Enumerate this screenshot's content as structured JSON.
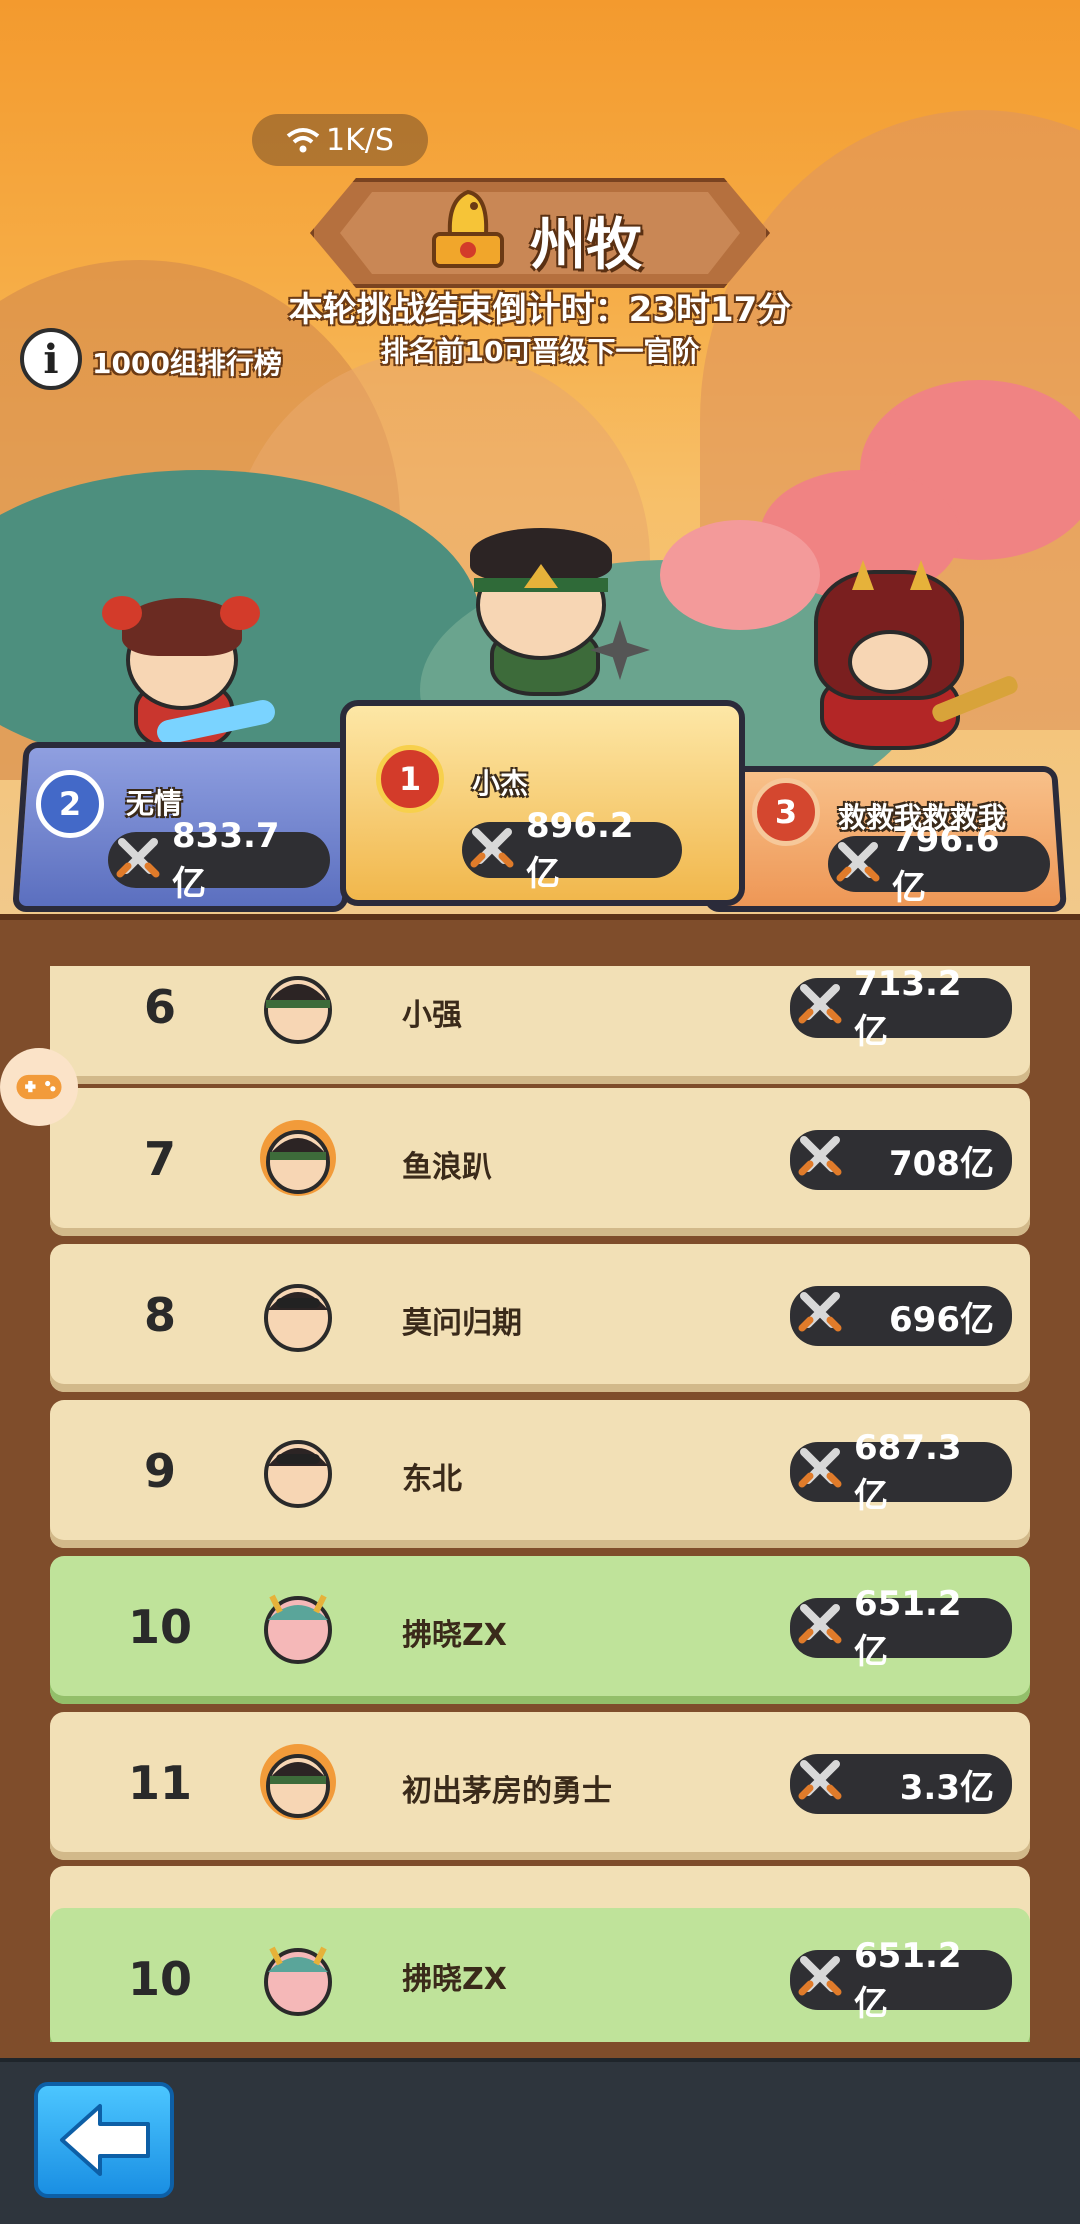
{
  "network": {
    "speed": "1K/S"
  },
  "header": {
    "title": "州牧",
    "countdown": "本轮挑战结束倒计时：23时17分",
    "promote_note": "排名前10可晋级下一官阶",
    "info_label": "1000组排行榜"
  },
  "podium": [
    {
      "rank": "2",
      "name": "无情",
      "power": "833.7亿"
    },
    {
      "rank": "1",
      "name": "小杰",
      "power": "896.2亿"
    },
    {
      "rank": "3",
      "name": "救救我救救我",
      "power": "796.6亿"
    }
  ],
  "list": [
    {
      "rank": "6",
      "name": "小强",
      "power": "713.2亿",
      "highlight": false
    },
    {
      "rank": "7",
      "name": "鱼浪趴",
      "power": "708亿",
      "highlight": false
    },
    {
      "rank": "8",
      "name": "莫问归期",
      "power": "696亿",
      "highlight": false
    },
    {
      "rank": "9",
      "name": "东北",
      "power": "687.3亿",
      "highlight": false
    },
    {
      "rank": "10",
      "name": "拂晓ZX",
      "power": "651.2亿",
      "highlight": true
    },
    {
      "rank": "11",
      "name": "初出茅房的勇士",
      "power": "3.3亿",
      "highlight": false
    }
  ],
  "self_row": {
    "rank": "10",
    "name": "拂晓ZX",
    "power": "651.2亿"
  },
  "colors": {
    "highlight_row": "#bfe39a",
    "normal_row": "#f2e0b6",
    "board": "#7f4d2b"
  },
  "icons": [
    "wifi-icon",
    "seal-icon",
    "info-icon",
    "crossed-swords-icon",
    "gamepad-icon",
    "back-arrow-icon"
  ]
}
